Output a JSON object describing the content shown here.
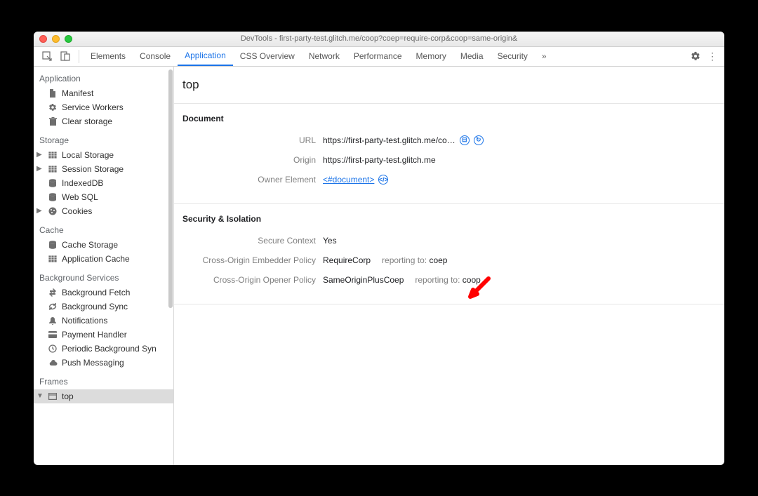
{
  "window": {
    "title": "DevTools - first-party-test.glitch.me/coop?coep=require-corp&coop=same-origin&"
  },
  "tabs": {
    "items": [
      "Elements",
      "Console",
      "Application",
      "CSS Overview",
      "Network",
      "Performance",
      "Memory",
      "Media",
      "Security"
    ],
    "active_index": 2
  },
  "sidebar": {
    "application": {
      "title": "Application",
      "manifest": "Manifest",
      "service_workers": "Service Workers",
      "clear_storage": "Clear storage"
    },
    "storage": {
      "title": "Storage",
      "local_storage": "Local Storage",
      "session_storage": "Session Storage",
      "indexeddb": "IndexedDB",
      "web_sql": "Web SQL",
      "cookies": "Cookies"
    },
    "cache": {
      "title": "Cache",
      "cache_storage": "Cache Storage",
      "app_cache": "Application Cache"
    },
    "bg": {
      "title": "Background Services",
      "bg_fetch": "Background Fetch",
      "bg_sync": "Background Sync",
      "notifications": "Notifications",
      "payment_handler": "Payment Handler",
      "pbs": "Periodic Background Syn",
      "push": "Push Messaging"
    },
    "frames": {
      "title": "Frames",
      "top": "top"
    }
  },
  "content": {
    "title": "top",
    "document": {
      "heading": "Document",
      "url_label": "URL",
      "url_value": "https://first-party-test.glitch.me/co…",
      "origin_label": "Origin",
      "origin_value": "https://first-party-test.glitch.me",
      "owner_label": "Owner Element",
      "owner_value": "<#document>"
    },
    "security": {
      "heading": "Security & Isolation",
      "sc_label": "Secure Context",
      "sc_value": "Yes",
      "coep_label": "Cross-Origin Embedder Policy",
      "coep_value": "RequireCorp",
      "coep_reporting_prefix": "reporting to:",
      "coep_reporting_value": "coep",
      "coop_label": "Cross-Origin Opener Policy",
      "coop_value": "SameOriginPlusCoep",
      "coop_reporting_prefix": "reporting to:",
      "coop_reporting_value": "coop"
    }
  }
}
